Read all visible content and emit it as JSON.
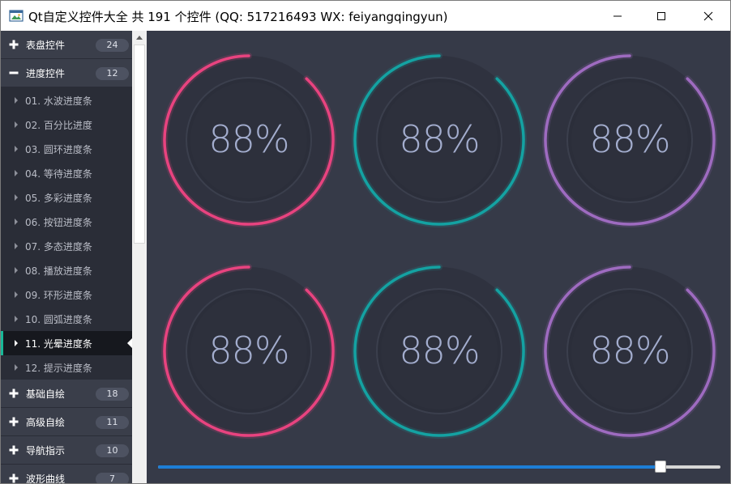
{
  "window": {
    "title": "Qt自定义控件大全 共 191 个控件 (QQ: 517216493 WX: feiyangqingyun)"
  },
  "sidebar": {
    "groups_top": [
      {
        "label": "表盘控件",
        "count": "24",
        "icon": "plus-icon",
        "expanded": false
      },
      {
        "label": "进度控件",
        "count": "12",
        "icon": "minus-icon",
        "expanded": true
      }
    ],
    "items": [
      {
        "label": "01. 水波进度条"
      },
      {
        "label": "02. 百分比进度"
      },
      {
        "label": "03. 圆环进度条"
      },
      {
        "label": "04. 等待进度条"
      },
      {
        "label": "05. 多彩进度条"
      },
      {
        "label": "06. 按钮进度条"
      },
      {
        "label": "07. 多态进度条"
      },
      {
        "label": "08. 播放进度条"
      },
      {
        "label": "09. 环形进度条"
      },
      {
        "label": "10. 圆弧进度条"
      },
      {
        "label": "11. 光晕进度条",
        "active": true
      },
      {
        "label": "12. 提示进度条"
      }
    ],
    "groups_bottom": [
      {
        "label": "基础自绘",
        "count": "18",
        "icon": "plus-icon"
      },
      {
        "label": "高级自绘",
        "count": "11",
        "icon": "plus-icon"
      },
      {
        "label": "导航指示",
        "count": "10",
        "icon": "plus-icon"
      },
      {
        "label": "波形曲线",
        "count": "7",
        "icon": "plus-icon"
      }
    ],
    "accent_color": "#18b797"
  },
  "dials": [
    {
      "value": 88,
      "text": "88%",
      "color": "#e8437f"
    },
    {
      "value": 88,
      "text": "88%",
      "color": "#14a2a2"
    },
    {
      "value": 88,
      "text": "88%",
      "color": "#9e6bc0"
    },
    {
      "value": 88,
      "text": "88%",
      "color": "#e8437f"
    },
    {
      "value": 88,
      "text": "88%",
      "color": "#14a2a2"
    },
    {
      "value": 88,
      "text": "88%",
      "color": "#9e6bc0"
    }
  ],
  "slider": {
    "value_fraction": 0.88,
    "fill_color": "#1d7ed6"
  }
}
